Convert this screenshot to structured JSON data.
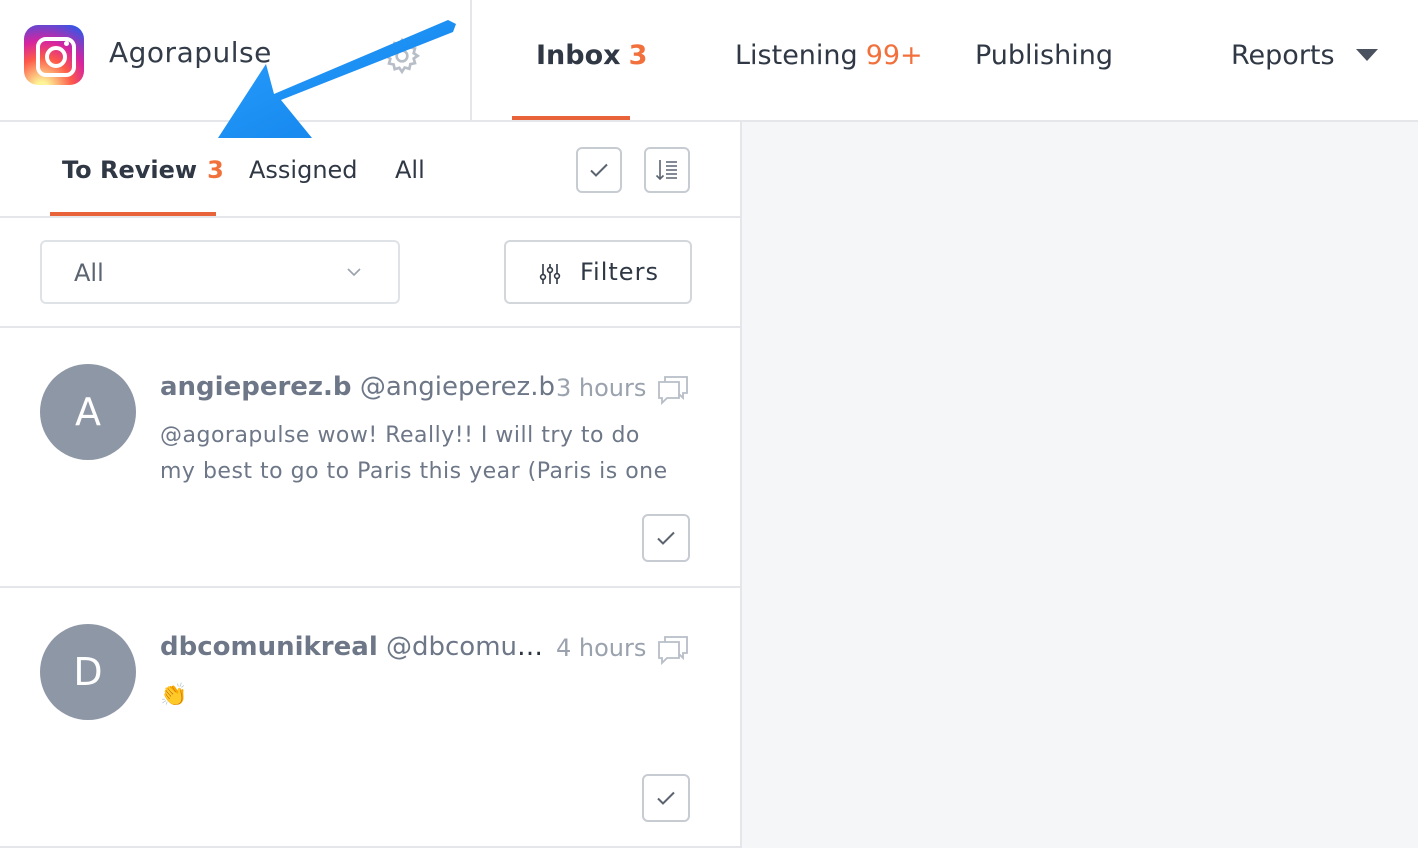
{
  "brand": {
    "name": "Agorapulse",
    "logo_icon": "instagram-logo",
    "settings_icon": "gear-icon"
  },
  "nav": {
    "inbox": {
      "label": "Inbox",
      "badge": "3"
    },
    "listening": {
      "label": "Listening",
      "badge": "99+"
    },
    "publishing": {
      "label": "Publishing"
    },
    "reports": {
      "label": "Reports"
    }
  },
  "subtabs": {
    "to_review": {
      "label": "To Review",
      "badge": "3"
    },
    "assigned": {
      "label": "Assigned"
    },
    "all": {
      "label": "All"
    }
  },
  "toolbar": {
    "mark_all_icon": "check-icon",
    "sort_icon": "sort-icon"
  },
  "filter": {
    "select_value": "All",
    "filters_label": "Filters"
  },
  "items": [
    {
      "avatar_letter": "A",
      "name": "angieperez.b",
      "handle": "@angieperez.b",
      "time": "3 hours",
      "text": "@agorapulse wow! Really!! I will try to do my best to go to Paris this year (Paris is one of my favorite cities in the world"
    },
    {
      "avatar_letter": "D",
      "name": "dbcomunikreal",
      "handle": "@dbcomunikreal",
      "time": "4 hours",
      "text": "👏"
    }
  ],
  "colors": {
    "accent": "#e8633a",
    "badge": "#f2703b",
    "annotation_arrow": "#1a8cff",
    "avatar": "#8e97a6"
  }
}
